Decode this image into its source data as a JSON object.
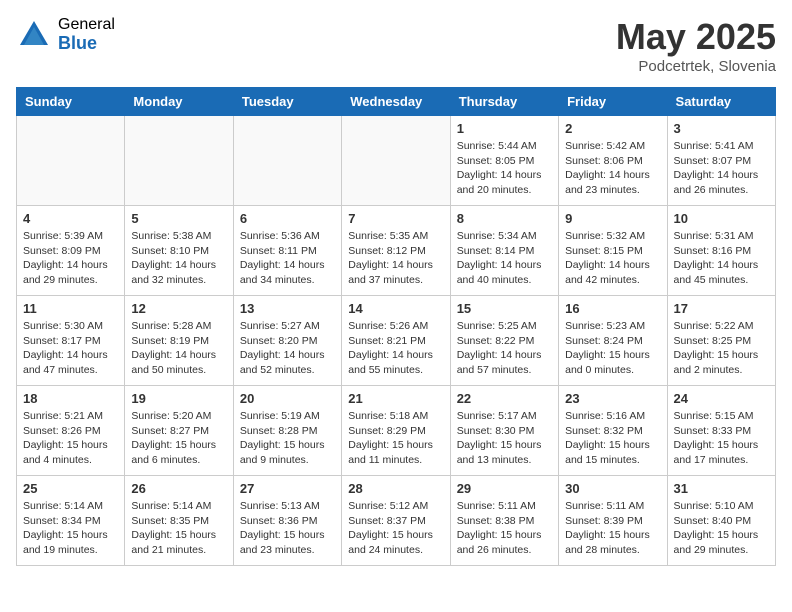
{
  "header": {
    "logo_general": "General",
    "logo_blue": "Blue",
    "title": "May 2025",
    "subtitle": "Podcetrtek, Slovenia"
  },
  "days_of_week": [
    "Sunday",
    "Monday",
    "Tuesday",
    "Wednesday",
    "Thursday",
    "Friday",
    "Saturday"
  ],
  "weeks": [
    [
      {
        "day": "",
        "info": ""
      },
      {
        "day": "",
        "info": ""
      },
      {
        "day": "",
        "info": ""
      },
      {
        "day": "",
        "info": ""
      },
      {
        "day": "1",
        "info": "Sunrise: 5:44 AM\nSunset: 8:05 PM\nDaylight: 14 hours and 20 minutes."
      },
      {
        "day": "2",
        "info": "Sunrise: 5:42 AM\nSunset: 8:06 PM\nDaylight: 14 hours and 23 minutes."
      },
      {
        "day": "3",
        "info": "Sunrise: 5:41 AM\nSunset: 8:07 PM\nDaylight: 14 hours and 26 minutes."
      }
    ],
    [
      {
        "day": "4",
        "info": "Sunrise: 5:39 AM\nSunset: 8:09 PM\nDaylight: 14 hours and 29 minutes."
      },
      {
        "day": "5",
        "info": "Sunrise: 5:38 AM\nSunset: 8:10 PM\nDaylight: 14 hours and 32 minutes."
      },
      {
        "day": "6",
        "info": "Sunrise: 5:36 AM\nSunset: 8:11 PM\nDaylight: 14 hours and 34 minutes."
      },
      {
        "day": "7",
        "info": "Sunrise: 5:35 AM\nSunset: 8:12 PM\nDaylight: 14 hours and 37 minutes."
      },
      {
        "day": "8",
        "info": "Sunrise: 5:34 AM\nSunset: 8:14 PM\nDaylight: 14 hours and 40 minutes."
      },
      {
        "day": "9",
        "info": "Sunrise: 5:32 AM\nSunset: 8:15 PM\nDaylight: 14 hours and 42 minutes."
      },
      {
        "day": "10",
        "info": "Sunrise: 5:31 AM\nSunset: 8:16 PM\nDaylight: 14 hours and 45 minutes."
      }
    ],
    [
      {
        "day": "11",
        "info": "Sunrise: 5:30 AM\nSunset: 8:17 PM\nDaylight: 14 hours and 47 minutes."
      },
      {
        "day": "12",
        "info": "Sunrise: 5:28 AM\nSunset: 8:19 PM\nDaylight: 14 hours and 50 minutes."
      },
      {
        "day": "13",
        "info": "Sunrise: 5:27 AM\nSunset: 8:20 PM\nDaylight: 14 hours and 52 minutes."
      },
      {
        "day": "14",
        "info": "Sunrise: 5:26 AM\nSunset: 8:21 PM\nDaylight: 14 hours and 55 minutes."
      },
      {
        "day": "15",
        "info": "Sunrise: 5:25 AM\nSunset: 8:22 PM\nDaylight: 14 hours and 57 minutes."
      },
      {
        "day": "16",
        "info": "Sunrise: 5:23 AM\nSunset: 8:24 PM\nDaylight: 15 hours and 0 minutes."
      },
      {
        "day": "17",
        "info": "Sunrise: 5:22 AM\nSunset: 8:25 PM\nDaylight: 15 hours and 2 minutes."
      }
    ],
    [
      {
        "day": "18",
        "info": "Sunrise: 5:21 AM\nSunset: 8:26 PM\nDaylight: 15 hours and 4 minutes."
      },
      {
        "day": "19",
        "info": "Sunrise: 5:20 AM\nSunset: 8:27 PM\nDaylight: 15 hours and 6 minutes."
      },
      {
        "day": "20",
        "info": "Sunrise: 5:19 AM\nSunset: 8:28 PM\nDaylight: 15 hours and 9 minutes."
      },
      {
        "day": "21",
        "info": "Sunrise: 5:18 AM\nSunset: 8:29 PM\nDaylight: 15 hours and 11 minutes."
      },
      {
        "day": "22",
        "info": "Sunrise: 5:17 AM\nSunset: 8:30 PM\nDaylight: 15 hours and 13 minutes."
      },
      {
        "day": "23",
        "info": "Sunrise: 5:16 AM\nSunset: 8:32 PM\nDaylight: 15 hours and 15 minutes."
      },
      {
        "day": "24",
        "info": "Sunrise: 5:15 AM\nSunset: 8:33 PM\nDaylight: 15 hours and 17 minutes."
      }
    ],
    [
      {
        "day": "25",
        "info": "Sunrise: 5:14 AM\nSunset: 8:34 PM\nDaylight: 15 hours and 19 minutes."
      },
      {
        "day": "26",
        "info": "Sunrise: 5:14 AM\nSunset: 8:35 PM\nDaylight: 15 hours and 21 minutes."
      },
      {
        "day": "27",
        "info": "Sunrise: 5:13 AM\nSunset: 8:36 PM\nDaylight: 15 hours and 23 minutes."
      },
      {
        "day": "28",
        "info": "Sunrise: 5:12 AM\nSunset: 8:37 PM\nDaylight: 15 hours and 24 minutes."
      },
      {
        "day": "29",
        "info": "Sunrise: 5:11 AM\nSunset: 8:38 PM\nDaylight: 15 hours and 26 minutes."
      },
      {
        "day": "30",
        "info": "Sunrise: 5:11 AM\nSunset: 8:39 PM\nDaylight: 15 hours and 28 minutes."
      },
      {
        "day": "31",
        "info": "Sunrise: 5:10 AM\nSunset: 8:40 PM\nDaylight: 15 hours and 29 minutes."
      }
    ]
  ]
}
